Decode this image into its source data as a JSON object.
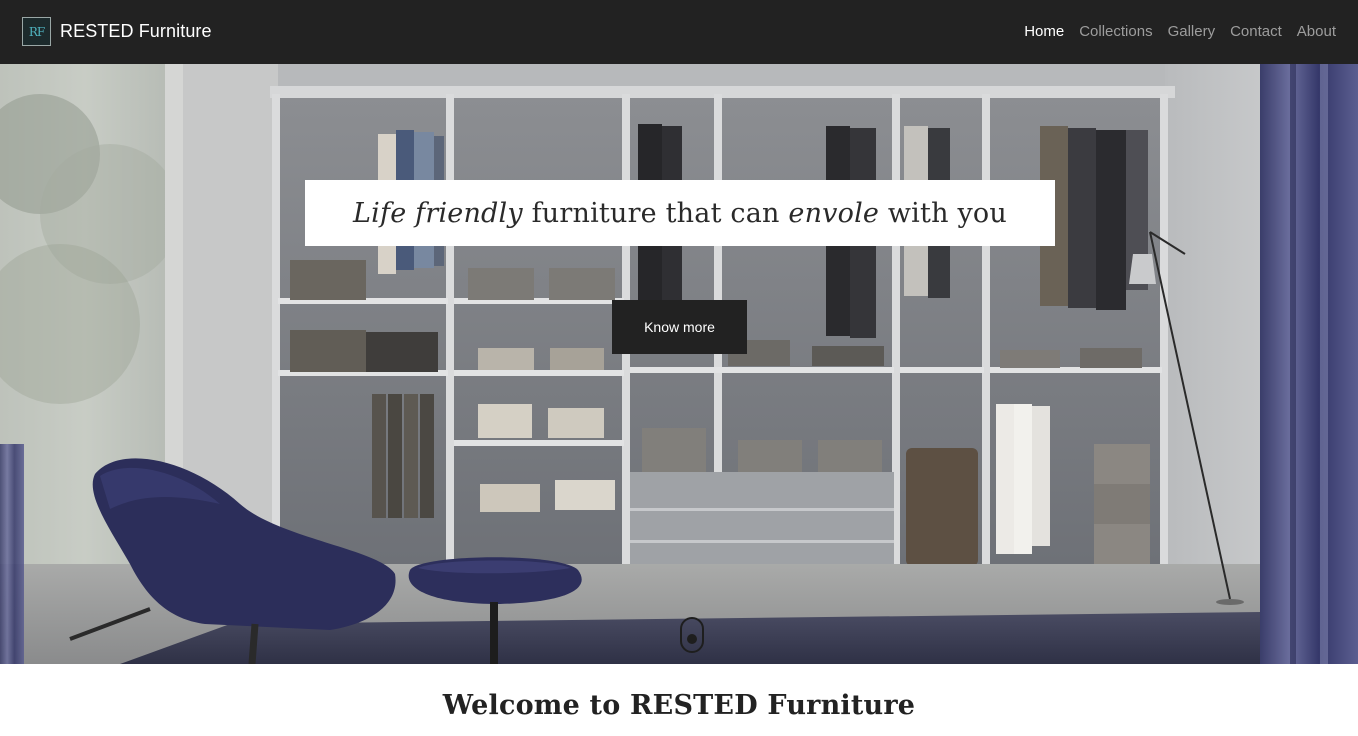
{
  "brand": {
    "logo_text": "RF",
    "name": "RESTED Furniture"
  },
  "nav": {
    "items": [
      {
        "label": "Home",
        "active": true
      },
      {
        "label": "Collections",
        "active": false
      },
      {
        "label": "Gallery",
        "active": false
      },
      {
        "label": "Contact",
        "active": false
      },
      {
        "label": "About",
        "active": false
      }
    ]
  },
  "hero": {
    "tagline": {
      "part1": "Life friendly",
      "part2": " furniture that can ",
      "part3": "envole",
      "part4": " with you"
    },
    "button_label": "Know more",
    "background_description_icon": "wardrobe-photo"
  },
  "welcome": {
    "heading": "Welcome to RESTED Furniture"
  },
  "colors": {
    "navbar_bg": "#222222",
    "nav_active": "#ffffff",
    "nav_inactive": "#9d9d9d",
    "button_bg": "#222222"
  }
}
